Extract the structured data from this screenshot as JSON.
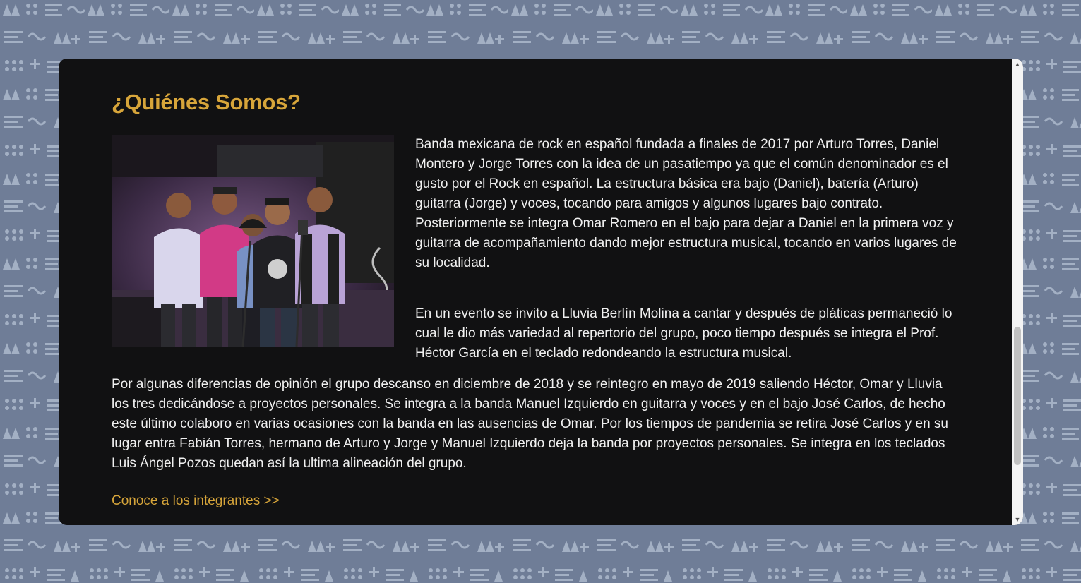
{
  "section": {
    "title": "¿Quiénes Somos?",
    "paragraphs": [
      "Banda mexicana de rock en español fundada a finales de 2017 por Arturo Torres, Daniel Montero y Jorge Torres con la idea de un pasatiempo ya que el común denominador es el gusto por el Rock en español. La estructura básica era bajo (Daniel), batería (Arturo) guitarra (Jorge) y voces, tocando para amigos y algunos lugares bajo contrato. Posteriormente se integra Omar Romero en el bajo para dejar a Daniel en la primera voz y guitarra de acompañamiento dando mejor estructura musical, tocando en varios lugares de su localidad.",
      "En un evento se invito a Lluvia Berlín Molina a cantar y después de pláticas permaneció lo cual le dio más variedad al repertorio del grupo, poco tiempo después se integra el Prof. Héctor García en el teclado redondeando la estructura musical.",
      "Por algunas diferencias de opinión el grupo descanso en diciembre de 2018 y se reintegro en mayo de 2019 saliendo Héctor, Omar y Lluvia los tres dedicándose a proyectos personales. Se integra a la banda Manuel Izquierdo en guitarra y voces y en el bajo José Carlos, de hecho este último colaboro en varias ocasiones con la banda en las ausencias de Omar. Por los tiempos de pandemia se retira José Carlos y en su lugar entra Fabián Torres, hermano de Arturo y Jorge y Manuel Izquierdo deja la banda por proyectos personales. Se integra en los teclados Luis Ángel Pozos quedan así la ultima alineación del grupo."
    ],
    "link_label": "Conoce a los integrantes >>"
  },
  "scrollbar": {
    "up_icon": "▲",
    "down_icon": "▼"
  },
  "colors": {
    "accent": "#d7a53a",
    "panel": "#111112",
    "page_background": "#6f7d97",
    "pattern": "#a0adc2"
  },
  "icons": {
    "band_photo": "group-photo",
    "scroll_up": "triangle-up-icon",
    "scroll_down": "triangle-down-icon"
  }
}
